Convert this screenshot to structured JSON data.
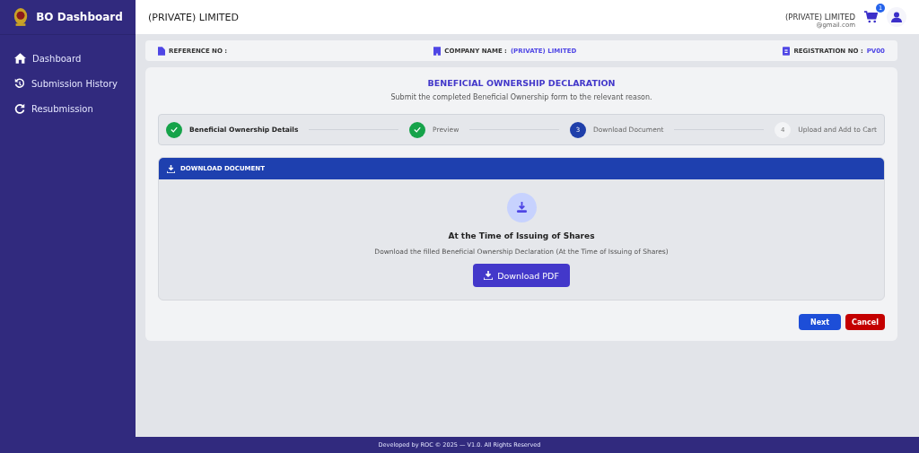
{
  "sidebar": {
    "title": "BO Dashboard",
    "items": [
      {
        "label": "Dashboard",
        "selected": false
      },
      {
        "label": "Submission History",
        "selected": false
      },
      {
        "label": "Resubmission",
        "selected": false
      }
    ]
  },
  "header": {
    "company": "(PRIVATE) LIMITED",
    "user_company": "(PRIVATE) LIMITED",
    "user_email": "@gmail.com",
    "cart_count": "1"
  },
  "info_bar": [
    {
      "label": "REFERENCE NO :"
    },
    {
      "label": "COMPANY NAME :",
      "value": "(PRIVATE) LIMITED"
    },
    {
      "label": "REGISTRATION NO :",
      "value": "PV00"
    }
  ],
  "page": {
    "title": "BENEFICIAL OWNERSHIP DECLARATION",
    "subtitle": "Submit the completed Beneficial Ownership form to the relevant reason."
  },
  "steps": [
    {
      "label": "Beneficial Ownership Details",
      "completed": true,
      "active": false,
      "selected": true
    },
    {
      "label": "Preview",
      "completed": true,
      "active": false,
      "selected": false
    },
    {
      "number": "3",
      "label": "Download Document",
      "completed": false,
      "active": true,
      "selected": false
    },
    {
      "number": "4",
      "label": "Upload and Add to Cart",
      "completed": false,
      "active": false,
      "selected": false
    }
  ],
  "download": {
    "header": "DOWNLOAD DOCUMENT",
    "title": "At the Time of Issuing of Shares",
    "description": "Download the filled Beneficial Ownership Declaration (At the Time of Issuing of Shares)",
    "button": "Download PDF"
  },
  "buttons": [
    {
      "label": "Next",
      "kind": "primary"
    },
    {
      "label": "Cancel",
      "kind": "danger"
    }
  ],
  "footer": "Developed by ROC © 2025 — V1.0. All Rights Reserved"
}
